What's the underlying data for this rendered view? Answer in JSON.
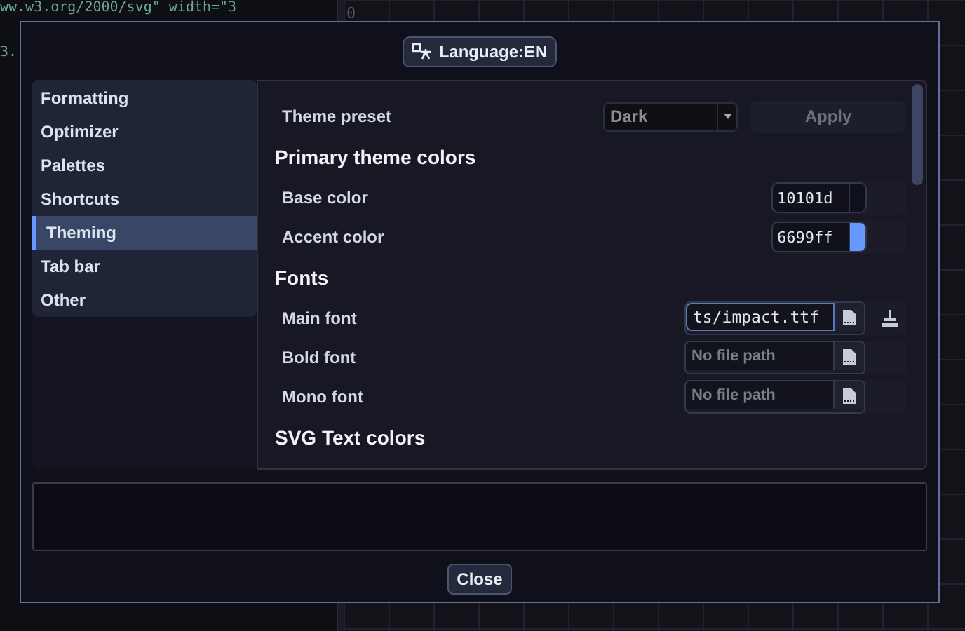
{
  "background": {
    "code_lines": [
      "ww.w3.org/2000/svg\" width=\"3",
      "3."
    ],
    "ruler_label": "0"
  },
  "dialog": {
    "language_button": "Language:EN",
    "sidebar": [
      {
        "label": "Formatting",
        "selected": false
      },
      {
        "label": "Optimizer",
        "selected": false
      },
      {
        "label": "Palettes",
        "selected": false
      },
      {
        "label": "Shortcuts",
        "selected": false
      },
      {
        "label": "Theming",
        "selected": true
      },
      {
        "label": "Tab bar",
        "selected": false
      },
      {
        "label": "Other",
        "selected": false
      }
    ],
    "settings": [
      {
        "kind": "select",
        "label": "Theme preset",
        "value": "Dark",
        "button": "Apply"
      },
      {
        "kind": "heading",
        "label": "Primary theme colors"
      },
      {
        "kind": "color",
        "label": "Base color",
        "value": "10101d",
        "color": "#10101d"
      },
      {
        "kind": "color",
        "label": "Accent color",
        "value": "6699ff",
        "color": "#6699ff"
      },
      {
        "kind": "heading",
        "label": "Fonts"
      },
      {
        "kind": "file",
        "label": "Main font",
        "value": "ts/impact.ttf",
        "focused": true,
        "clearable": true
      },
      {
        "kind": "file",
        "label": "Bold font",
        "placeholder": "No file path",
        "focused": false,
        "clearable": false
      },
      {
        "kind": "file",
        "label": "Mono font",
        "placeholder": "No file path",
        "focused": false,
        "clearable": false
      },
      {
        "kind": "heading",
        "label": "SVG Text colors"
      }
    ],
    "close_button": "Close"
  }
}
